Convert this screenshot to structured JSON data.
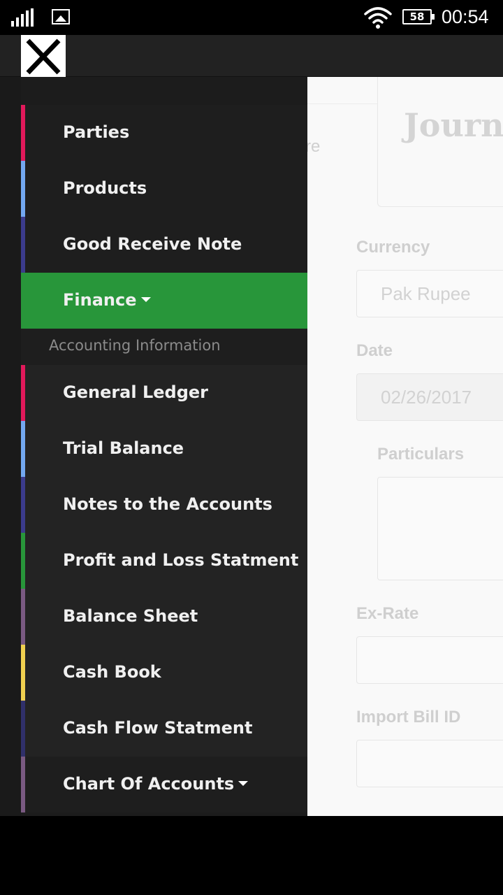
{
  "status_bar": {
    "battery": "58",
    "time": "00:54",
    "icons": [
      "signal-icon",
      "gallery-icon",
      "wifi-icon",
      "battery-icon"
    ]
  },
  "app_bar": {
    "close_icon": "close-icon"
  },
  "drawer": {
    "top_items": [
      {
        "label": "Parties",
        "color": "#e2195b"
      },
      {
        "label": "Products",
        "color": "#73a8f0"
      },
      {
        "label": "Good Receive Note",
        "color": "#3b3b8c"
      }
    ],
    "active_item": {
      "label": "Finance",
      "color": "#28963a"
    },
    "section_header": "Accounting Information",
    "sub_items": [
      {
        "label": "General Ledger",
        "color": "#e2195b"
      },
      {
        "label": "Trial Balance",
        "color": "#73a8f0"
      },
      {
        "label": "Notes to the Accounts",
        "color": "#3b3b8c"
      },
      {
        "label": "Profit and Loss Statment",
        "color": "#28963a"
      },
      {
        "label": "Balance Sheet",
        "color": "#7a5a82"
      },
      {
        "label": "Cash Book",
        "color": "#f0d050"
      },
      {
        "label": "Cash Flow Statment",
        "color": "#30306a"
      }
    ],
    "bottom_item": {
      "label": "Chart Of Accounts",
      "color": "#7a5a82"
    }
  },
  "page": {
    "title": "Journa",
    "partial_tab_text": "re",
    "fields": {
      "currency_label": "Currency",
      "currency_value": "Pak Rupee",
      "date_label": "Date",
      "date_value": "02/26/2017",
      "particulars_label": "Particulars",
      "ex_rate_label": "Ex-Rate",
      "import_bill_label": "Import Bill ID"
    }
  }
}
